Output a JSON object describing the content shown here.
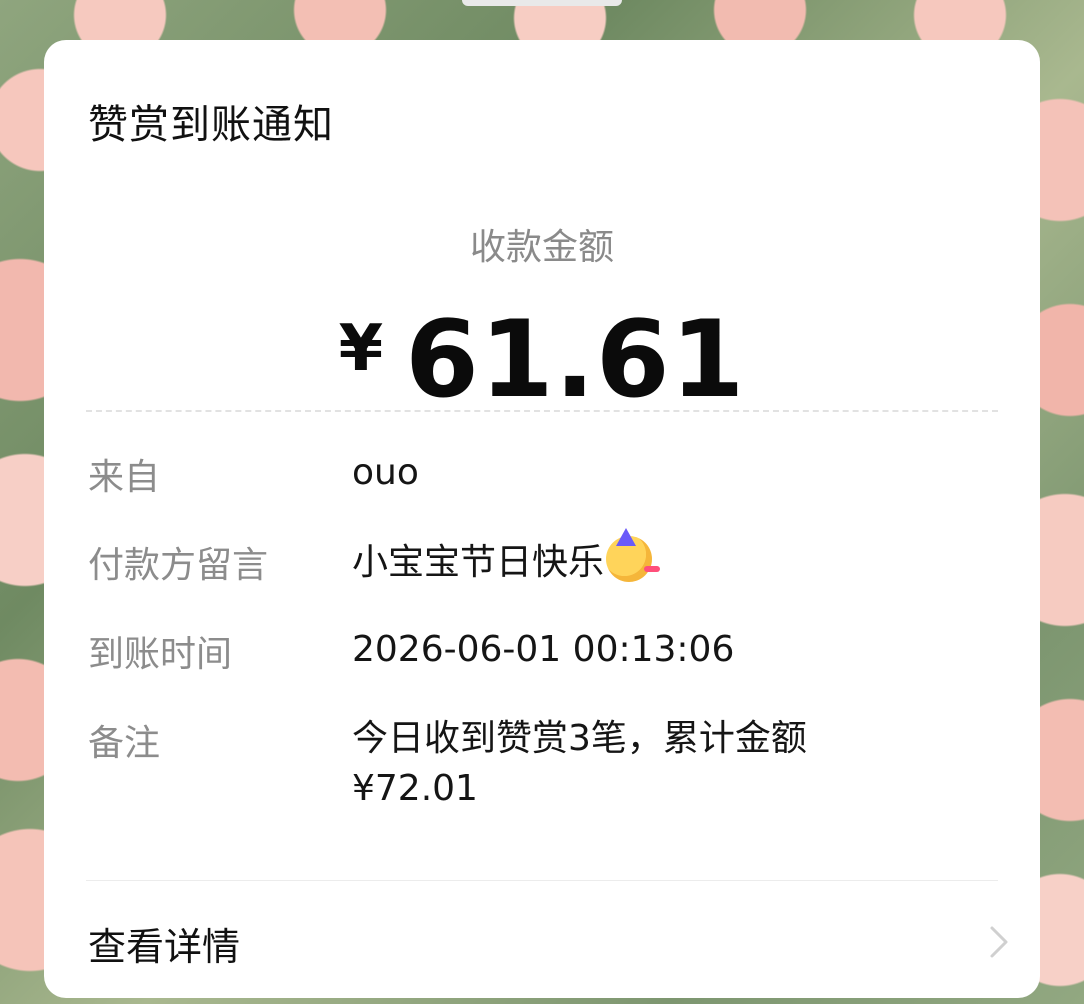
{
  "card": {
    "title": "赞赏到账通知",
    "amount_label": "收款金额",
    "amount_currency": "¥",
    "amount_value": "61.61",
    "rows": [
      {
        "key": "来自",
        "value": "ouo"
      },
      {
        "key": "付款方留言",
        "value": "小宝宝节日快乐",
        "emoji": "partying-face-emoji"
      },
      {
        "key": "到账时间",
        "value": "2026-06-01 00:13:06"
      },
      {
        "key": "备注",
        "value": "今日收到赞赏3笔，累计金额",
        "value_line2": "¥72.01"
      }
    ],
    "details_label": "查看详情",
    "details_icon": "chevron-right-icon"
  },
  "colors": {
    "card_bg": "#ffffff",
    "key_text": "#8c8c8c",
    "value_text": "#151515"
  }
}
